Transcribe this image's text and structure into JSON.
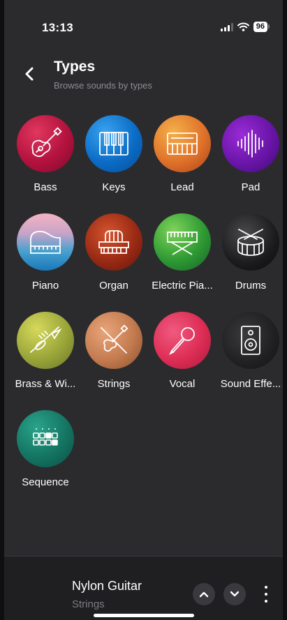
{
  "status_bar": {
    "time": "13:13",
    "battery": "96"
  },
  "header": {
    "title": "Types",
    "subtitle": "Browse sounds by types"
  },
  "types": [
    {
      "label": "Bass",
      "icon": "guitar-icon"
    },
    {
      "label": "Keys",
      "icon": "keyboard-icon"
    },
    {
      "label": "Lead",
      "icon": "synth-icon"
    },
    {
      "label": "Pad",
      "icon": "waveform-icon"
    },
    {
      "label": "Piano",
      "icon": "grand-piano-icon"
    },
    {
      "label": "Organ",
      "icon": "organ-icon"
    },
    {
      "label": "Electric Pia...",
      "icon": "electric-piano-icon"
    },
    {
      "label": "Drums",
      "icon": "drum-icon"
    },
    {
      "label": "Brass & Wi...",
      "icon": "trumpet-icon"
    },
    {
      "label": "Strings",
      "icon": "violin-icon"
    },
    {
      "label": "Vocal",
      "icon": "microphone-icon"
    },
    {
      "label": "Sound Effe...",
      "icon": "speaker-icon"
    },
    {
      "label": "Sequence",
      "icon": "sequencer-grid-icon"
    }
  ],
  "player": {
    "title": "Nylon Guitar",
    "subtitle": "Strings"
  },
  "colors": {
    "background": "#2b2b2e",
    "player_background": "#1f1f22",
    "subtitle_gray": "#8d8d92"
  }
}
